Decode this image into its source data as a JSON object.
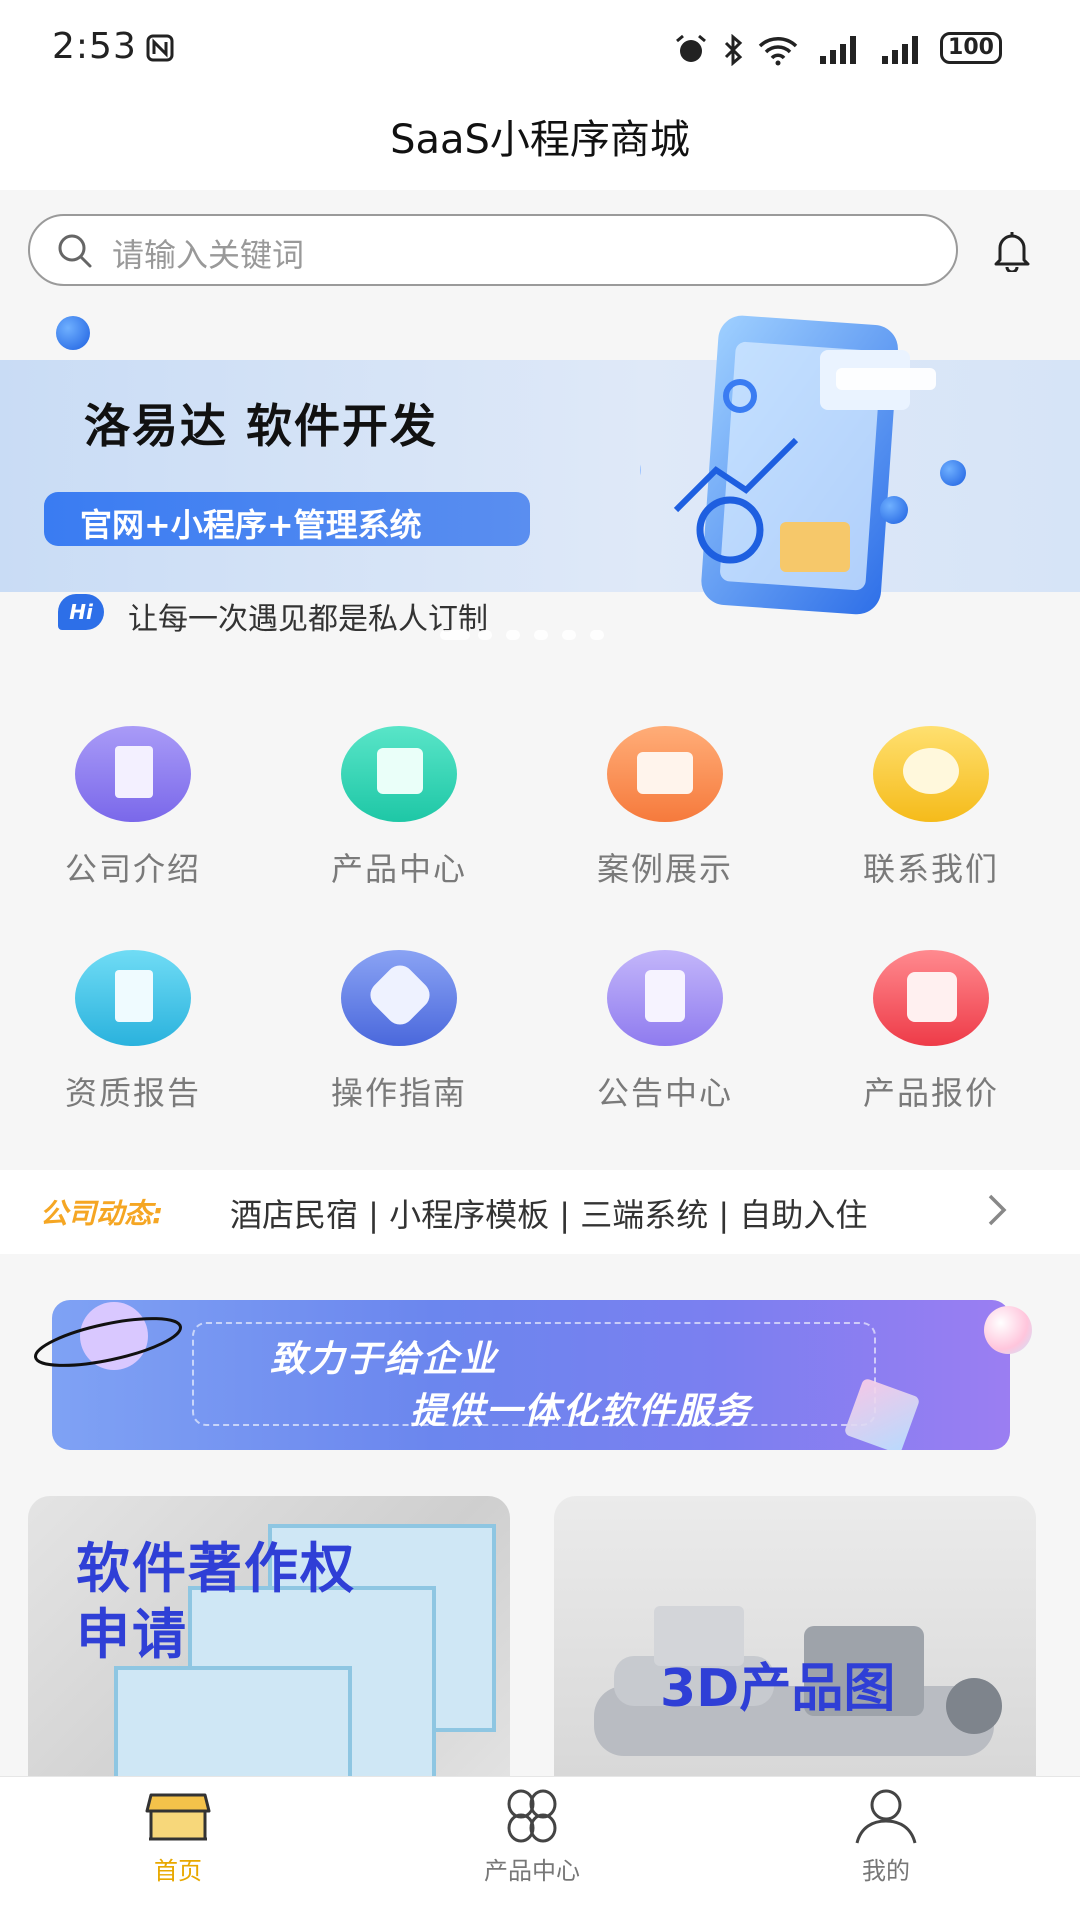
{
  "status_bar": {
    "time": "2:53",
    "battery": "100"
  },
  "header": {
    "title": "SaaS小程序商城"
  },
  "search": {
    "placeholder": "请输入关键词"
  },
  "banner": {
    "title": "洛易达 软件开发",
    "pill": "官网+小程序+管理系统",
    "hi_badge": "Hi",
    "subtitle": "让每一次遇见都是私人订制"
  },
  "nav": [
    {
      "label": "公司介绍",
      "icon": "book-icon",
      "color": "#8a7cf0"
    },
    {
      "label": "产品中心",
      "icon": "shopping-bag-icon",
      "color": "#2fd4b4"
    },
    {
      "label": "案例展示",
      "icon": "mail-icon",
      "color": "#fb8c52"
    },
    {
      "label": "联系我们",
      "icon": "chat-bubble-icon",
      "color": "#f7c633"
    },
    {
      "label": "资质报告",
      "icon": "document-icon",
      "color": "#3ec4e6"
    },
    {
      "label": "操作指南",
      "icon": "verified-badge-icon",
      "color": "#5a7de8"
    },
    {
      "label": "公告中心",
      "icon": "edit-note-icon",
      "color": "#9f8cf3"
    },
    {
      "label": "产品报价",
      "icon": "price-tag-icon",
      "color": "#f4535e"
    }
  ],
  "news": {
    "tag": "公司动态:",
    "text": "酒店民宿 | 小程序模板 | 三端系统 | 自助入住"
  },
  "promo": {
    "line1": "致力于给企业",
    "line2": "提供一体化软件服务"
  },
  "cards": [
    {
      "title_line1": "软件著作权",
      "title_line2": "申请"
    },
    {
      "title": "3D产品图"
    }
  ],
  "tabbar": [
    {
      "label": "首页",
      "icon": "store-icon",
      "active": true
    },
    {
      "label": "产品中心",
      "icon": "clover-grid-icon",
      "active": false
    },
    {
      "label": "我的",
      "icon": "user-icon",
      "active": false
    }
  ]
}
